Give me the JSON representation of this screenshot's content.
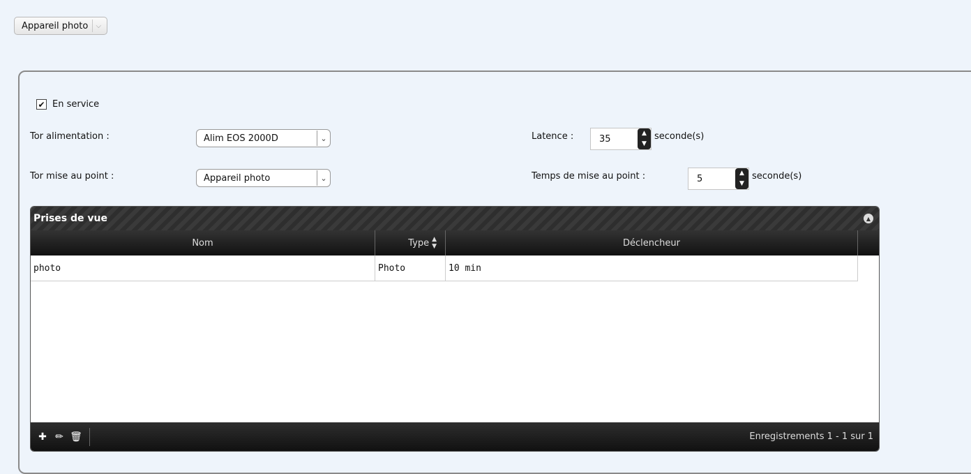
{
  "top_select": {
    "value": "Appareil photo"
  },
  "form": {
    "in_service": {
      "label": "En service",
      "checked": true
    },
    "tor_alimentation": {
      "label": "Tor alimentation :",
      "value": "Alim EOS 2000D"
    },
    "tor_mise_au_point": {
      "label": "Tor mise au point :",
      "value": "Appareil photo"
    },
    "latence": {
      "label": "Latence :",
      "value": "35",
      "unit": "seconde(s)"
    },
    "temps_mise_au_point": {
      "label": "Temps de mise au point :",
      "value": "5",
      "unit": "seconde(s)"
    }
  },
  "grid": {
    "title": "Prises de vue",
    "columns": [
      "Nom",
      "Type",
      "Déclencheur"
    ],
    "sort_indicator": "▲▼",
    "rows": [
      {
        "nom": "photo",
        "type": "Photo",
        "declencheur": "10 min"
      }
    ],
    "footer_info": "Enregistrements 1 - 1 sur 1",
    "icons": {
      "add": "plus-icon",
      "edit": "pencil-icon",
      "delete": "trash-icon",
      "collapse": "collapse-icon"
    }
  }
}
